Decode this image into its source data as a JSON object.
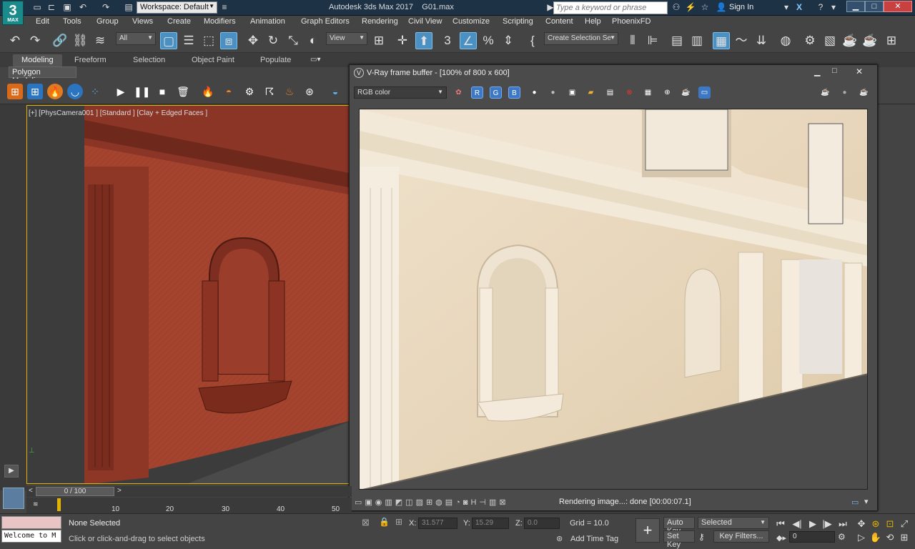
{
  "app": {
    "logo_text": "3",
    "logo_sub": "MAX",
    "workspace_label": "Workspace: Default",
    "title": "Autodesk 3ds Max 2017",
    "filename": "G01.max",
    "search_placeholder": "Type a keyword or phrase",
    "sign_in": "Sign In"
  },
  "menu": [
    "Edit",
    "Tools",
    "Group",
    "Views",
    "Create",
    "Modifiers",
    "Animation",
    "Graph Editors",
    "Rendering",
    "Civil View",
    "Customize",
    "Scripting",
    "Content",
    "Help",
    "PhoenixFD"
  ],
  "toolbar": {
    "filter_dropdown": "All",
    "refcoord_dropdown": "View",
    "selection_set_dropdown": "Create Selection Se"
  },
  "ribbon": {
    "tabs": [
      "Modeling",
      "Freeform",
      "Selection",
      "Object Paint",
      "Populate"
    ],
    "active_tab": "Modeling",
    "panel_label": "Polygon Modeling"
  },
  "viewport": {
    "label": "[+] [PhysCamera001 ] [Standard ] [Clay + Edged Faces ]"
  },
  "vray": {
    "title": "V-Ray frame buffer - [100% of 800 x 600]",
    "channel": "RGB color",
    "channel_buttons": [
      "R",
      "G",
      "B"
    ],
    "status": "Rendering image...: done [00:00:07.1]"
  },
  "timeline": {
    "slider": "0 / 100",
    "ticks": [
      "10",
      "20",
      "30",
      "40",
      "50"
    ]
  },
  "status": {
    "selection": "None Selected",
    "prompt": "Click or click-and-drag to select objects",
    "welcome": "Welcome to M",
    "x_label": "X:",
    "x_value": "31.577",
    "y_label": "Y:",
    "y_value": "15.29",
    "z_label": "Z:",
    "z_value": "0.0",
    "grid": "Grid = 10.0",
    "add_time_tag": "Add Time Tag",
    "auto_key": "Auto Key",
    "set_key": "Set Key",
    "key_mode_dropdown": "Selected",
    "key_filters": "Key Filters...",
    "frame": "0"
  },
  "colors": {
    "titlebar": "#1e3246",
    "accent_active": "#4a90c2",
    "viewport_border": "#e2b200",
    "clay": "#a0422e"
  }
}
